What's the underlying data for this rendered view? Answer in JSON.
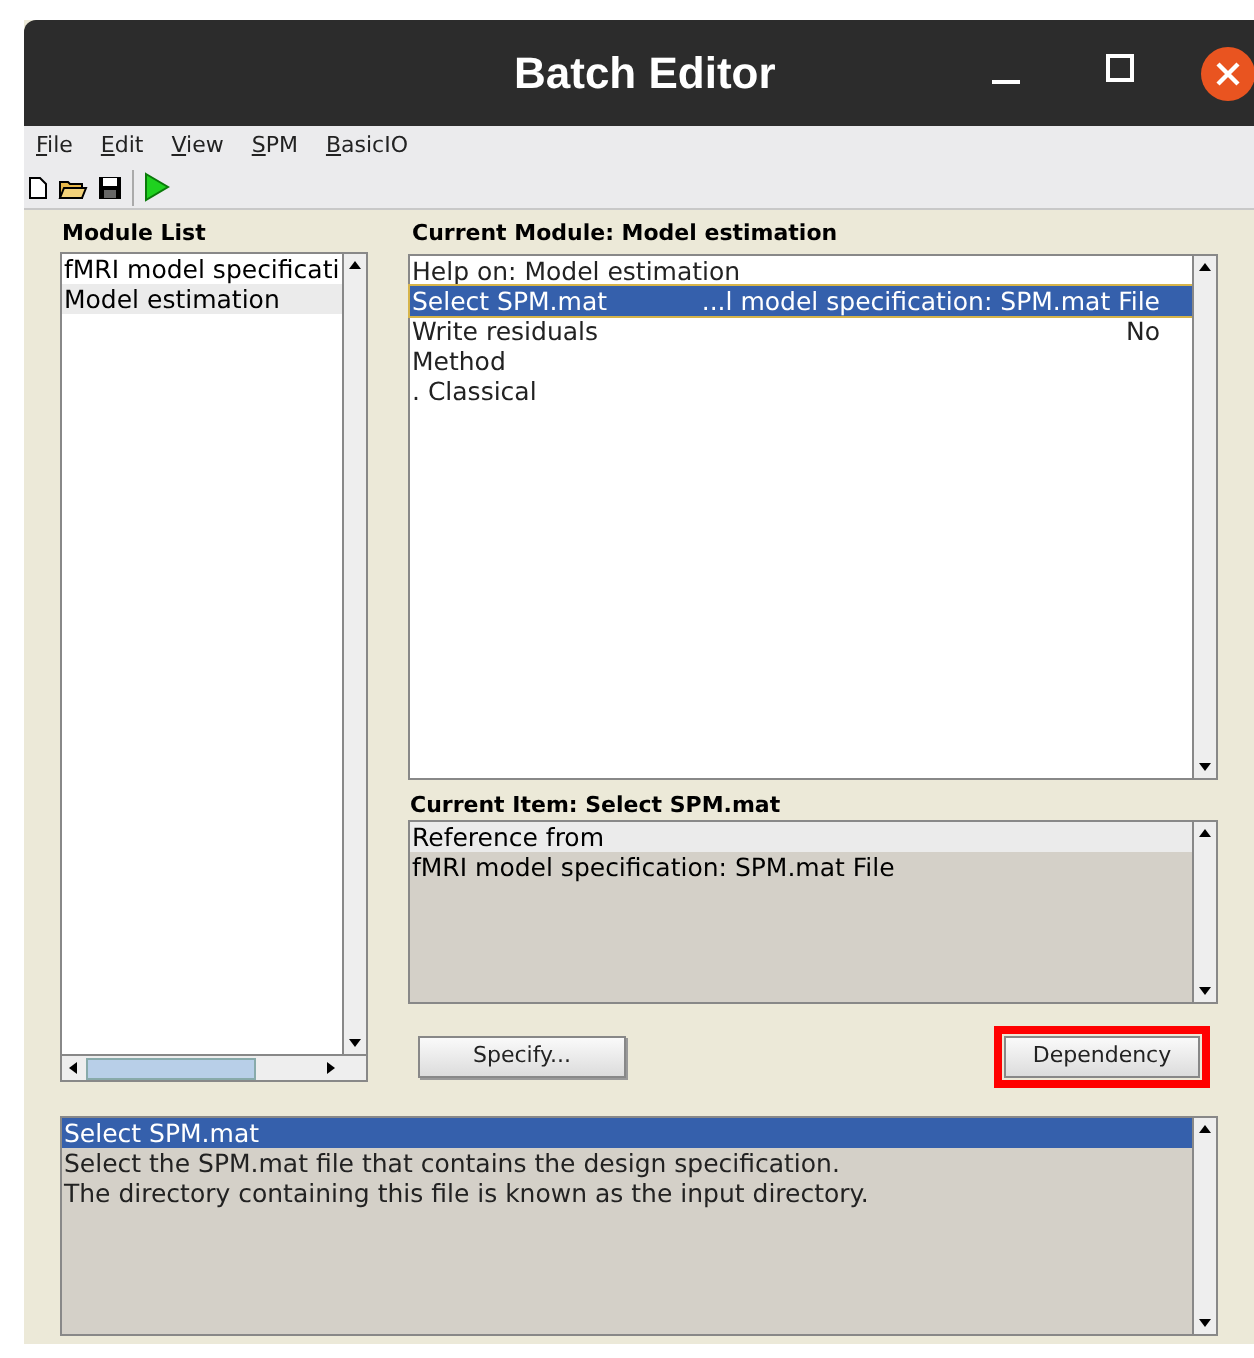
{
  "window": {
    "title": "Batch Editor"
  },
  "menu": [
    "File",
    "Edit",
    "View",
    "SPM",
    "BasicIO"
  ],
  "module_list": {
    "title": "Module List",
    "items": [
      {
        "label": "fMRI model specificati",
        "selected": false
      },
      {
        "label": "Model estimation",
        "selected": true
      }
    ]
  },
  "current_module": {
    "title": "Current Module: Model estimation",
    "rows": [
      {
        "label": "Help on: Model estimation",
        "selected": false
      },
      {
        "label": "Select SPM.mat",
        "value": "...l model specification: SPM.mat File",
        "selected": true
      },
      {
        "label": "Write residuals",
        "value": "No",
        "selected": false
      },
      {
        "label": "Method",
        "selected": false
      },
      {
        "label": ". Classical",
        "selected": false
      }
    ]
  },
  "current_item": {
    "title": "Current Item: Select SPM.mat",
    "lines": [
      "Reference from",
      "fMRI model specification: SPM.mat File"
    ]
  },
  "buttons": [
    {
      "label": "Specify...",
      "highlighted": false
    },
    {
      "label": "Dependency",
      "highlighted": true
    }
  ],
  "help": {
    "heading": "Select SPM.mat",
    "lines": [
      "Select the SPM.mat file that contains the design specification.",
      "The directory containing this file is known as the input directory."
    ]
  }
}
